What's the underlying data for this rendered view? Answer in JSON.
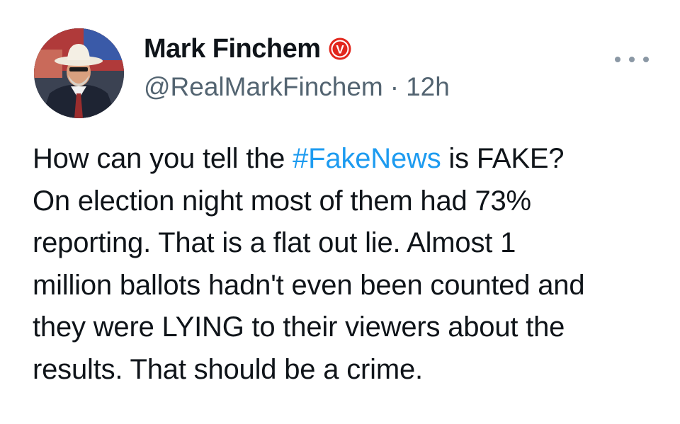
{
  "author": {
    "display_name": "Mark Finchem",
    "handle": "@RealMarkFinchem",
    "separator": "·",
    "time": "12h",
    "badge_letter": "V",
    "avatar_icon": "profile-photo-cowboy-hat",
    "badge_color": "#e2261c"
  },
  "menu": {
    "more_icon": "ellipsis-icon"
  },
  "tweet": {
    "lines": [
      {
        "before": "How can you tell the ",
        "hashtag": "#FakeNews",
        "after": " is FAKE?"
      },
      {
        "text": "On election night most of them had 73%"
      },
      {
        "text": "reporting. That is a flat out lie. Almost 1"
      },
      {
        "text": "million ballots hadn't even been counted and"
      },
      {
        "text": "they were LYING to their viewers about the"
      },
      {
        "text": "results. That should be a crime."
      }
    ],
    "hashtag_color": "#1d9bf0"
  }
}
